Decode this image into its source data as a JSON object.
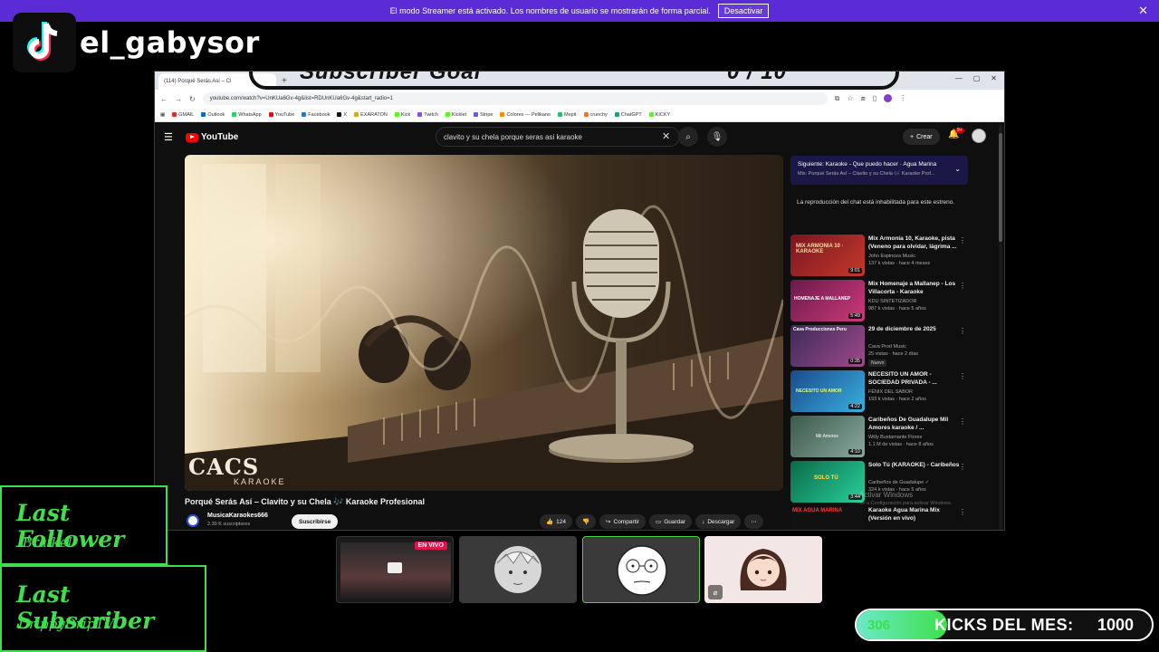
{
  "streamer_bar": {
    "message": "El modo Streamer está activado. Los nombres de usuario se mostrarán de forma parcial.",
    "deactivate_label": "Desactivar",
    "close_glyph": "✕"
  },
  "tiktok": {
    "handle": "el_gabysor",
    "icon": "tiktok-icon"
  },
  "browser": {
    "tab_title": "(114) Porqué Serás Así – Cl",
    "goal_overlay": {
      "label": "Subscriber Goal",
      "value": "0 / 10"
    },
    "url": "youtube.com/watch?v=UnKUa6Gv-4g&list=RDUnKUa6Gv-4g&start_radio=1",
    "bookmarks": [
      {
        "label": "GMAIL",
        "color": "#d93025"
      },
      {
        "label": "Outlook",
        "color": "#0a64d6"
      },
      {
        "label": "WhatsApp",
        "color": "#25d366"
      },
      {
        "label": "YouTube",
        "color": "#ff0000"
      },
      {
        "label": "Facebook",
        "color": "#1877f2"
      },
      {
        "label": "X",
        "color": "#111111"
      },
      {
        "label": "EXARATON",
        "color": "#e0a800"
      },
      {
        "label": "Kick",
        "color": "#53fc18"
      },
      {
        "label": "Twitch",
        "color": "#9146ff"
      },
      {
        "label": "Kicklet",
        "color": "#53fc18"
      },
      {
        "label": "Stripe",
        "color": "#635bff"
      },
      {
        "label": "Colores — Pelikano",
        "color": "#ff8a00"
      },
      {
        "label": "Mepit",
        "color": "#2dbd6e"
      },
      {
        "label": "crunchy",
        "color": "#f47521"
      },
      {
        "label": "ChatGPT",
        "color": "#10a37f"
      },
      {
        "label": "KICKY",
        "color": "#53fc18"
      }
    ]
  },
  "youtube": {
    "logo_text": "YouTube",
    "search_value": "clavito y su chela porque seras asi karaoke",
    "create_label": "Crear",
    "bell_badge": "9+",
    "video": {
      "title": "Porqué Serás Así – Clavito y su Chela 🎶 Karaoke Profesional",
      "logo_text": "CACS",
      "logo_sub": "KARAOKE",
      "channel": "MusicaKaraokes666",
      "subscribers": "2.39 K suscriptores",
      "subscribe_label": "Suscribirse",
      "likes": "124",
      "share_label": "Compartir",
      "save_label": "Guardar",
      "download_label": "Descargar"
    },
    "up_next": {
      "title": "Siguiente: Karaoke - Que puedo hacer · Agua Marina",
      "sub": "Mix: Porqué Serás Así – Clavito y su Chela 🎶 Karaoke Prof..."
    },
    "chat_disabled": "La reproducción del chat está inhabilitada para este estreno.",
    "recommendations": [
      {
        "title": "Mix Armonía 10, Karaoke, pista (Veneno para olvidar, lágrima ...",
        "channel": "John Espinoza Music",
        "meta": "137 k vistas · hace 4 meses",
        "duration": "9:01",
        "colors": [
          "#7a1422",
          "#c43a2a"
        ],
        "thumb_text": "MIX ARMONIA 10 · KARAOKE"
      },
      {
        "title": "Mix Homenaje a Mallanep - Los Villacorta - Karaoke",
        "channel": "KDU SINTETIZADOR",
        "meta": "987 k vistas · hace 5 años",
        "duration": "5:49",
        "colors": [
          "#6a1a4a",
          "#cc3a7a"
        ],
        "thumb_text": "HOMENAJE A MALLANEP"
      },
      {
        "title": "29 de diciembre de 2025",
        "channel": "Cava Prod Music",
        "meta": "25 vistas · hace 2 días",
        "duration": "0:35",
        "colors": [
          "#3a2a5a",
          "#a04a8a"
        ],
        "thumb_text": "Cava Producciones Peru",
        "badge": "Nuevo"
      },
      {
        "title": "NECESITO UN AMOR - SOCIEDAD PRIVADA - ...",
        "channel": "FÉNIX DEL SABOR",
        "meta": "193 k vistas · hace 2 años",
        "duration": "4:22",
        "colors": [
          "#1a4a8a",
          "#39b0e0"
        ],
        "thumb_text": "NECESITO UN AMOR"
      },
      {
        "title": "Caribeños De Guadalupe   Mil Amores   karaoke / ...",
        "channel": "Willy Bustamante Flores",
        "meta": "1.1 M de vistas · hace 8 años",
        "duration": "4:10",
        "colors": [
          "#3a5a4a",
          "#8aa8a0"
        ],
        "thumb_text": "Mil Amores"
      },
      {
        "title": "Solo Tú (KARAOKE) - Caribeños",
        "channel": "Caribeños de Guadalupe ✓",
        "meta": "324 k vistas · hace 5 años",
        "duration": "3:44",
        "colors": [
          "#0a6a4a",
          "#2ad09a"
        ],
        "thumb_text": "SOLO TÚ"
      },
      {
        "title": "Karaoke Agua Marina Mix (Versión en vivo)",
        "channel": "",
        "meta": "",
        "duration": "",
        "colors": [
          "#111111",
          "#333333"
        ],
        "thumb_text": "MIX AGUA MARINA"
      }
    ],
    "activate_windows": "Activar Windows",
    "activate_windows_sub": "Ve a Configuración para activar Windows."
  },
  "participants": {
    "live_label": "EN VIVO",
    "tiles": [
      "screen-share",
      "anime-avatar",
      "meme-face-avatar",
      "girl-avatar"
    ]
  },
  "last_follower": {
    "title": "Last Follower",
    "name": "lBraikel"
  },
  "last_subscriber": {
    "title": "Last Subscriber",
    "name": "DrippyDripTV"
  },
  "kicks": {
    "count": "306",
    "label": "KICKS DEL MES:",
    "goal": "1000",
    "progress_fraction": 0.306
  },
  "colors": {
    "accent_green": "#3de04b",
    "banner_purple": "#5b2bd6",
    "live_red": "#e0144c"
  }
}
